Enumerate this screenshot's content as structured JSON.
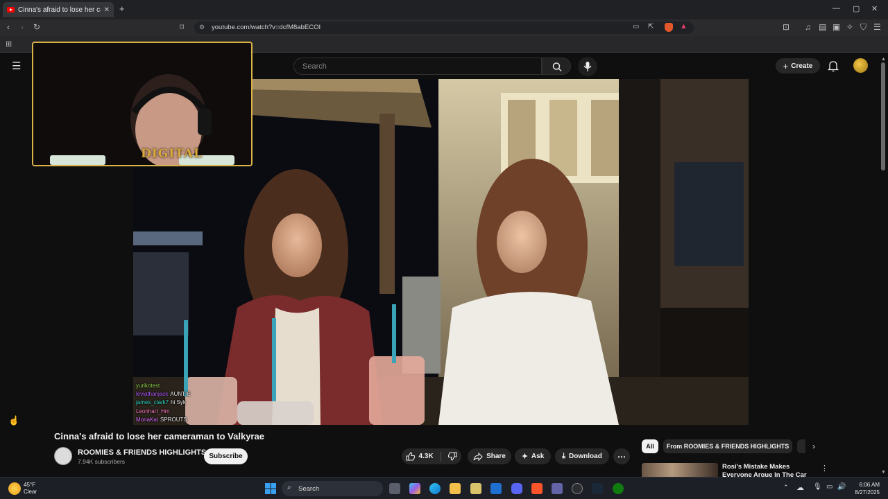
{
  "browser": {
    "tab_title": "Cinna's afraid to lose her cameraman to Valkyrae",
    "url": "youtube.com/watch?v=dcfM8abECOI"
  },
  "youtube": {
    "search_placeholder": "Search",
    "create_label": "Create",
    "video_title": "Cinna's afraid to lose her cameraman to Valkyrae",
    "channel_name": "ROOMIES & FRIENDS HIGHLIGHTS",
    "subscribers": "7.94K subscribers",
    "subscribe_label": "Subscribe",
    "like_count": "4.3K",
    "share_label": "Share",
    "ask_label": "Ask",
    "download_label": "Download",
    "chips": [
      "All",
      "From ROOMIES & FRIENDS HIGHLIGHTS"
    ],
    "recommended": [
      {
        "title": "Rosi's Mistake Makes Everyone Argue In The Car"
      }
    ]
  },
  "stream_overlay": {
    "logo_text": "DIGITAL",
    "chat": [
      {
        "user": "yurikotest",
        "message": "",
        "color": "#8fd14f"
      },
      {
        "user": "leviathanjack",
        "message": "AUNTIE",
        "color": "#b05cff"
      },
      {
        "user": "james_clark7",
        "message": "hi Syk",
        "color": "#2fd6c5"
      },
      {
        "user": "Leonhart_Hm",
        "message": "",
        "color": "#ff7ac0"
      },
      {
        "user": "MonaKat",
        "message": "SPROUTS",
        "color": "#d86bff"
      }
    ]
  },
  "taskbar": {
    "weather_temp": "45°F",
    "weather_condition": "Clear",
    "search_label": "Search",
    "time": "6:06 AM",
    "date": "8/27/2025"
  },
  "colors": {
    "youtube_red": "#ff0000",
    "overlay_gold": "#d9b24a",
    "background": "#0f0f0f"
  }
}
